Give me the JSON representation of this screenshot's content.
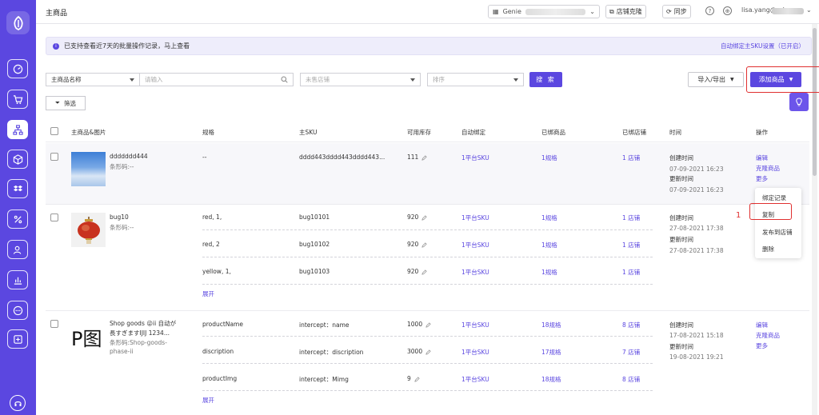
{
  "colors": {
    "brand": "#5b47e0",
    "highlight": "#e03030"
  },
  "topbar": {
    "title": "主商品",
    "shop_prefix": "Genie",
    "store_clone_label": "店铺克隆",
    "sync_label": "同步",
    "user_prefix": "lisa.yang@od"
  },
  "notice": {
    "message": "已支持查看近7天的批量操作记录，马上查看",
    "right_link": "自动绑定主SKU设置（已开启）"
  },
  "filters": {
    "field_select": "主商品名称",
    "keyword_placeholder": "请输入",
    "store_placeholder": "未售店铺",
    "sort_placeholder": "排序",
    "search_label": "搜 索",
    "import_export_label": "导入/导出",
    "add_product_label": "添加商品",
    "filter_label": "筛选"
  },
  "table": {
    "headers": [
      "主商品&图片",
      "规格",
      "主SKU",
      "可用库存",
      "自动绑定",
      "已绑商品",
      "已绑店铺",
      "时间",
      "操作"
    ],
    "row1": {
      "name": "ddddddd444",
      "barcode": "条形码:--",
      "spec": "--",
      "sku": "dddd443dddd443dddd443...",
      "stock": "111",
      "auto_bind": "1平台SKU",
      "bound_products": "1规格",
      "bound_stores": "1 店铺",
      "created_label": "创建时间",
      "created": "07-09-2021 16:23",
      "updated_label": "更新时间",
      "updated": "07-09-2021 16:23",
      "actions": [
        "编辑",
        "克隆商品",
        "更多"
      ]
    },
    "row2": {
      "name": "bug10",
      "barcode": "条形码:--",
      "variants": [
        {
          "spec": "red, 1,",
          "sku": "bug10101",
          "stock": "920",
          "auto_bind": "1平台SKU",
          "bound_products": "1规格",
          "bound_stores": "1 店铺"
        },
        {
          "spec": "red, 2",
          "sku": "bug10102",
          "stock": "920",
          "auto_bind": "1平台SKU",
          "bound_products": "1规格",
          "bound_stores": "1 店铺"
        },
        {
          "spec": "yellow, 1,",
          "sku": "bug10103",
          "stock": "920",
          "auto_bind": "1平台SKU",
          "bound_products": "1规格",
          "bound_stores": "1 店铺"
        }
      ],
      "expand_label": "展开",
      "created_label": "创建时间",
      "created": "27-08-2021 17:38",
      "updated_label": "更新时间",
      "updated": "27-08-2021 17:38"
    },
    "row3": {
      "name_line1": "Shop goods 😜ii 自动が",
      "name_line2": "長すぎますIJIJ 1234...",
      "barcode_line1": "条形码:Shop-goods-",
      "barcode_line2": "phase-ii",
      "thumb_text": "P图",
      "variants": [
        {
          "spec": "productName",
          "sku": "intercept：name",
          "stock": "1000",
          "auto_bind": "1平台SKU",
          "bound_products": "18规格",
          "bound_stores": "8 店铺"
        },
        {
          "spec": "discription",
          "sku": "intercept：discription",
          "stock": "3000",
          "auto_bind": "1平台SKU",
          "bound_products": "17规格",
          "bound_stores": "7 店铺"
        },
        {
          "spec": "productImg",
          "sku": "intercept：Mimg",
          "stock": "9",
          "auto_bind": "1平台SKU",
          "bound_products": "18规格",
          "bound_stores": "8 店铺"
        }
      ],
      "expand_label": "展开",
      "created_label": "创建时间",
      "created": "17-08-2021 15:18",
      "updated_label": "更新时间",
      "updated": "19-08-2021 19:21",
      "actions": [
        "编辑",
        "克隆商品",
        "更多"
      ]
    }
  },
  "more_menu": {
    "items": [
      "绑定记录",
      "复制",
      "发布到店铺",
      "删除"
    ],
    "annotation": "1"
  }
}
